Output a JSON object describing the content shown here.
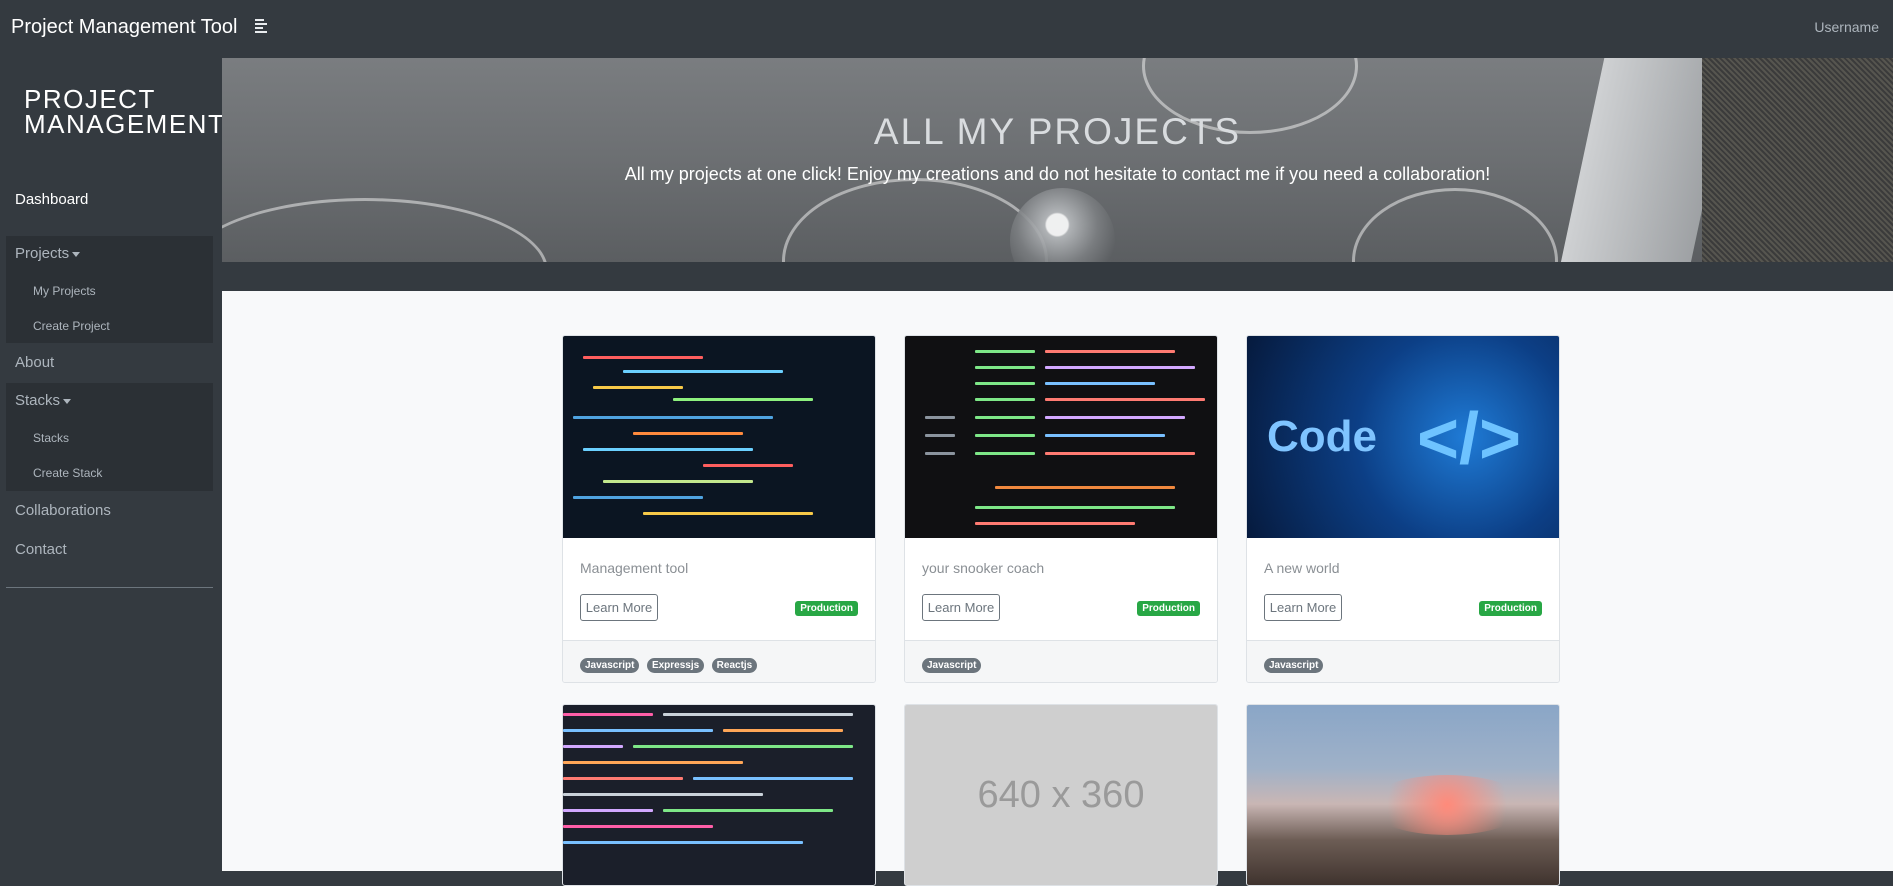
{
  "navbar": {
    "brand": "Project Management Tool",
    "toggle_icon": "menu-icon",
    "username": "Username"
  },
  "sidebar": {
    "title_line1": "PROJECT",
    "title_line2": "MANAGEMENT",
    "dashboard": "Dashboard",
    "projects": {
      "label": "Projects",
      "items": [
        "My Projects",
        "Create Project"
      ]
    },
    "about": "About",
    "stacks": {
      "label": "Stacks",
      "items": [
        "Stacks",
        "Create Stack"
      ]
    },
    "collaborations": "Collaborations",
    "contact": "Contact"
  },
  "hero": {
    "title": "ALL MY PROJECTS",
    "subtitle": "All my projects at one click! Enjoy my creations and do not hesitate to contact me if you need a collaboration!"
  },
  "cards": [
    {
      "title": "Management tool",
      "button": "Learn More",
      "status": "Production",
      "tags": [
        "Javascript",
        "Expressjs",
        "Reactjs"
      ]
    },
    {
      "title": "your snooker coach",
      "button": "Learn More",
      "status": "Production",
      "tags": [
        "Javascript"
      ]
    },
    {
      "title": "A new world",
      "button": "Learn More",
      "status": "Production",
      "tags": [
        "Javascript"
      ],
      "image_text": "Code"
    },
    {
      "image": "code"
    },
    {
      "image_text": "640 x 360"
    },
    {
      "image": "mountain"
    }
  ],
  "colors": {
    "badge_green": "#28a745",
    "tag_gray": "#6c757d",
    "sidebar": "#343a40"
  }
}
